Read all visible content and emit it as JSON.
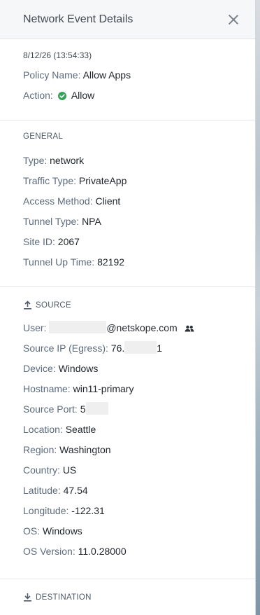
{
  "header": {
    "title": "Network Event Details"
  },
  "summary": {
    "timestamp": "8/12/26 (13:54:33)",
    "policy_name_label": "Policy Name:",
    "policy_name_value": "Allow Apps",
    "action_label": "Action:",
    "action_value": "Allow",
    "action_status_color": "#3aa15a"
  },
  "general": {
    "title": "GENERAL",
    "rows": [
      {
        "label": "Type:",
        "value": "network"
      },
      {
        "label": "Traffic Type:",
        "value": "PrivateApp"
      },
      {
        "label": "Access Method:",
        "value": "Client"
      },
      {
        "label": "Tunnel Type:",
        "value": "NPA"
      },
      {
        "label": "Site ID:",
        "value": "2067"
      },
      {
        "label": "Tunnel Up Time:",
        "value": "82192"
      }
    ]
  },
  "source": {
    "title": "SOURCE",
    "user_label": "User:",
    "user_value": "@netskope.com",
    "source_ip_label": "Source IP (Egress):",
    "source_ip_prefix": "76.",
    "source_ip_suffix": "1",
    "device_label": "Device:",
    "device_value": "Windows",
    "hostname_label": "Hostname:",
    "hostname_value": "win11-primary",
    "source_port_label": "Source Port:",
    "source_port_value": "5",
    "location_label": "Location:",
    "location_value": "Seattle",
    "region_label": "Region:",
    "region_value": "Washington",
    "country_label": "Country:",
    "country_value": "US",
    "latitude_label": "Latitude:",
    "latitude_value": "47.54",
    "longitude_label": "Longitude:",
    "longitude_value": "-122.31",
    "os_label": "OS:",
    "os_value": "Windows",
    "os_version_label": "OS Version:",
    "os_version_value": "11.0.28000"
  },
  "destination": {
    "title": "DESTINATION"
  }
}
